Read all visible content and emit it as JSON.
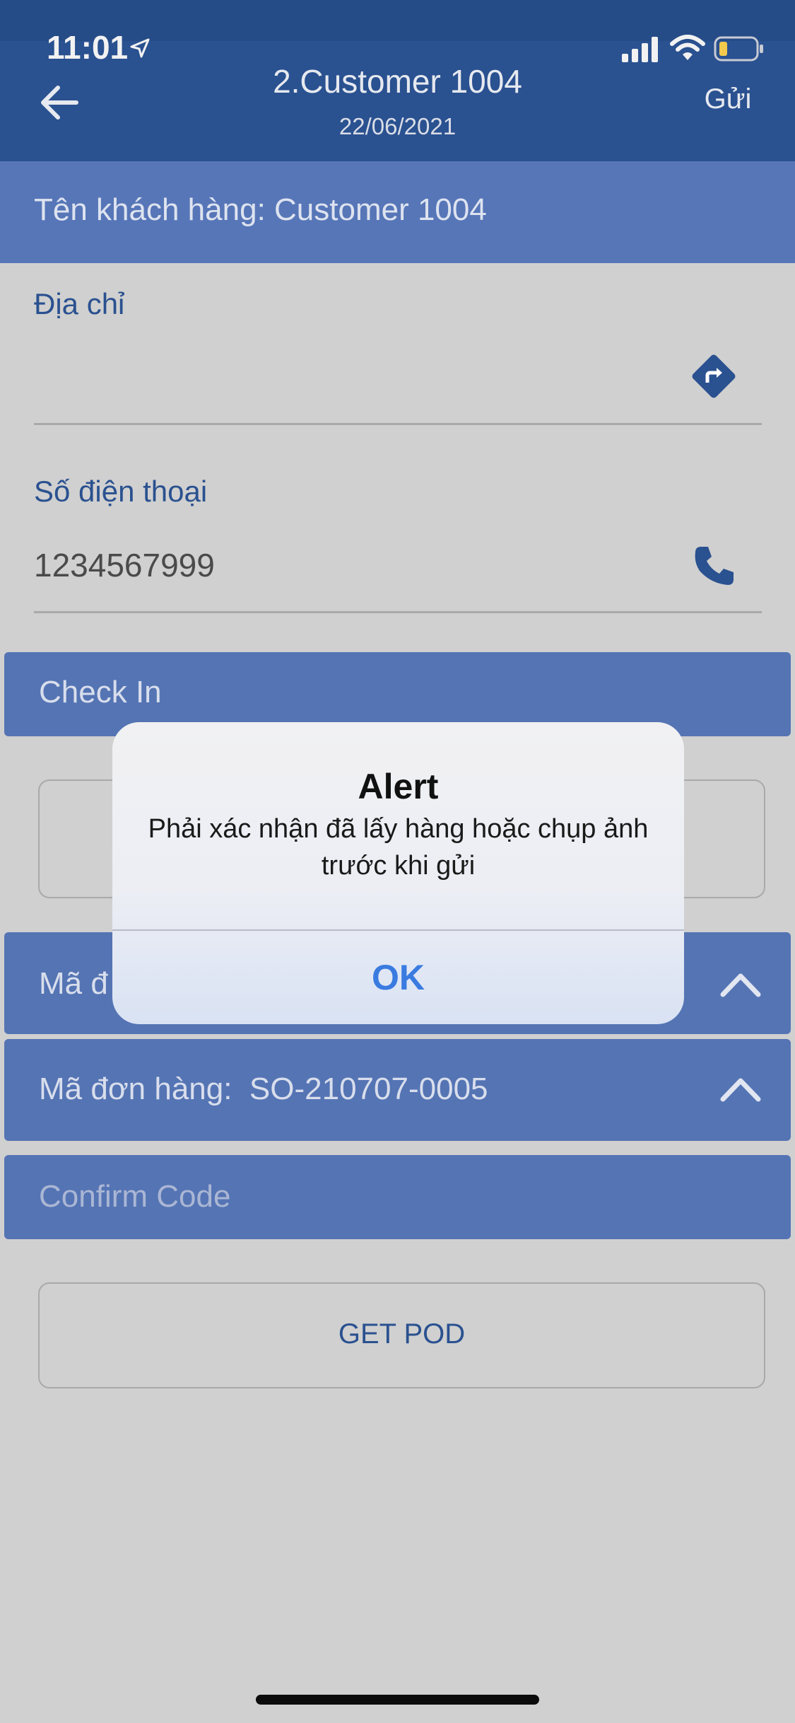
{
  "status_bar": {
    "time": "11:01"
  },
  "header": {
    "title": "2.Customer 1004",
    "date": "22/06/2021",
    "send_label": "Gửi"
  },
  "customer": {
    "name_text": "Tên khách hàng: Customer 1004"
  },
  "address": {
    "label": "Địa chỉ",
    "value": ""
  },
  "phone": {
    "label": "Số điện thoại",
    "value": "1234567999"
  },
  "checkin": {
    "label": "Check In"
  },
  "orders": [
    {
      "label": "Mã đ"
    },
    {
      "label": "Mã đơn hàng:  SO-210707-0005"
    }
  ],
  "confirm_code": {
    "placeholder": "Confirm Code"
  },
  "get_pod": {
    "label": "GET POD"
  },
  "alert": {
    "title": "Alert",
    "message": "Phải xác nhận đã lấy hàng hoặc chụp ảnh trước khi gửi",
    "ok_label": "OK"
  },
  "colors": {
    "header": "#2a5190",
    "band": "#5574b4",
    "accent": "#3a7be0",
    "battery_low": "#f2c94c"
  }
}
